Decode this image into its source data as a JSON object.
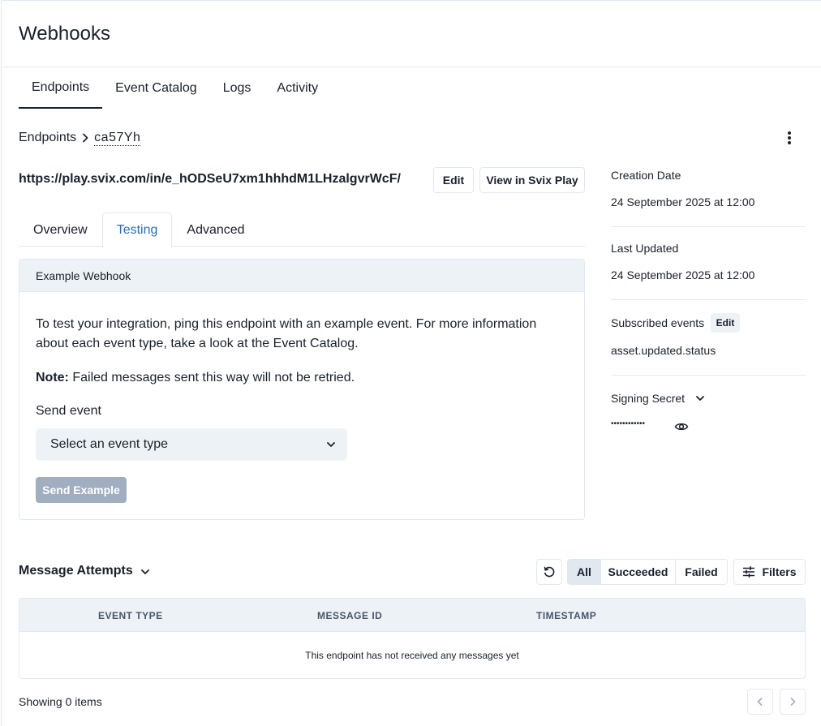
{
  "page": {
    "title": "Webhooks"
  },
  "main_tabs": [
    {
      "label": "Endpoints",
      "active": true
    },
    {
      "label": "Event Catalog",
      "active": false
    },
    {
      "label": "Logs",
      "active": false
    },
    {
      "label": "Activity",
      "active": false
    }
  ],
  "breadcrumb": {
    "root": "Endpoints",
    "current": "ca57Yh"
  },
  "endpoint": {
    "url": "https://play.svix.com/in/e_hODSeU7xm1hhhdM1LHzalgvrWcF/",
    "edit_label": "Edit",
    "play_label": "View in Svix Play"
  },
  "sub_tabs": [
    {
      "label": "Overview",
      "active": false
    },
    {
      "label": "Testing",
      "active": true
    },
    {
      "label": "Advanced",
      "active": false
    }
  ],
  "testing": {
    "card_title": "Example Webhook",
    "description": "To test your integration, ping this endpoint with an example event. For more information about each event type, take a look at the Event Catalog.",
    "note_label": "Note:",
    "note_text": " Failed messages sent this way will not be retried.",
    "send_label": "Send event",
    "select_placeholder": "Select an event type",
    "send_button": "Send Example"
  },
  "meta": {
    "creation_label": "Creation Date",
    "creation_value": "24 September 2025 at 12:00",
    "updated_label": "Last Updated",
    "updated_value": "24 September 2025 at 12:00",
    "subscribed_label": "Subscribed events",
    "subscribed_edit": "Edit",
    "subscribed_value": "asset.updated.status",
    "secret_label": "Signing Secret",
    "secret_masked": "••••••••••••"
  },
  "attempts": {
    "title": "Message Attempts",
    "filters": [
      {
        "label": "All",
        "active": true
      },
      {
        "label": "Succeeded",
        "active": false
      },
      {
        "label": "Failed",
        "active": false
      }
    ],
    "filters_button": "Filters",
    "columns": [
      "EVENT TYPE",
      "MESSAGE ID",
      "TIMESTAMP"
    ],
    "empty_text": "This endpoint has not received any messages yet",
    "showing": "Showing 0 items"
  },
  "colors": {
    "accent": "#2b6cb0",
    "border": "#e2e8f0",
    "muted_bg": "#edf2f7",
    "disabled_button": "#a0aec0"
  }
}
